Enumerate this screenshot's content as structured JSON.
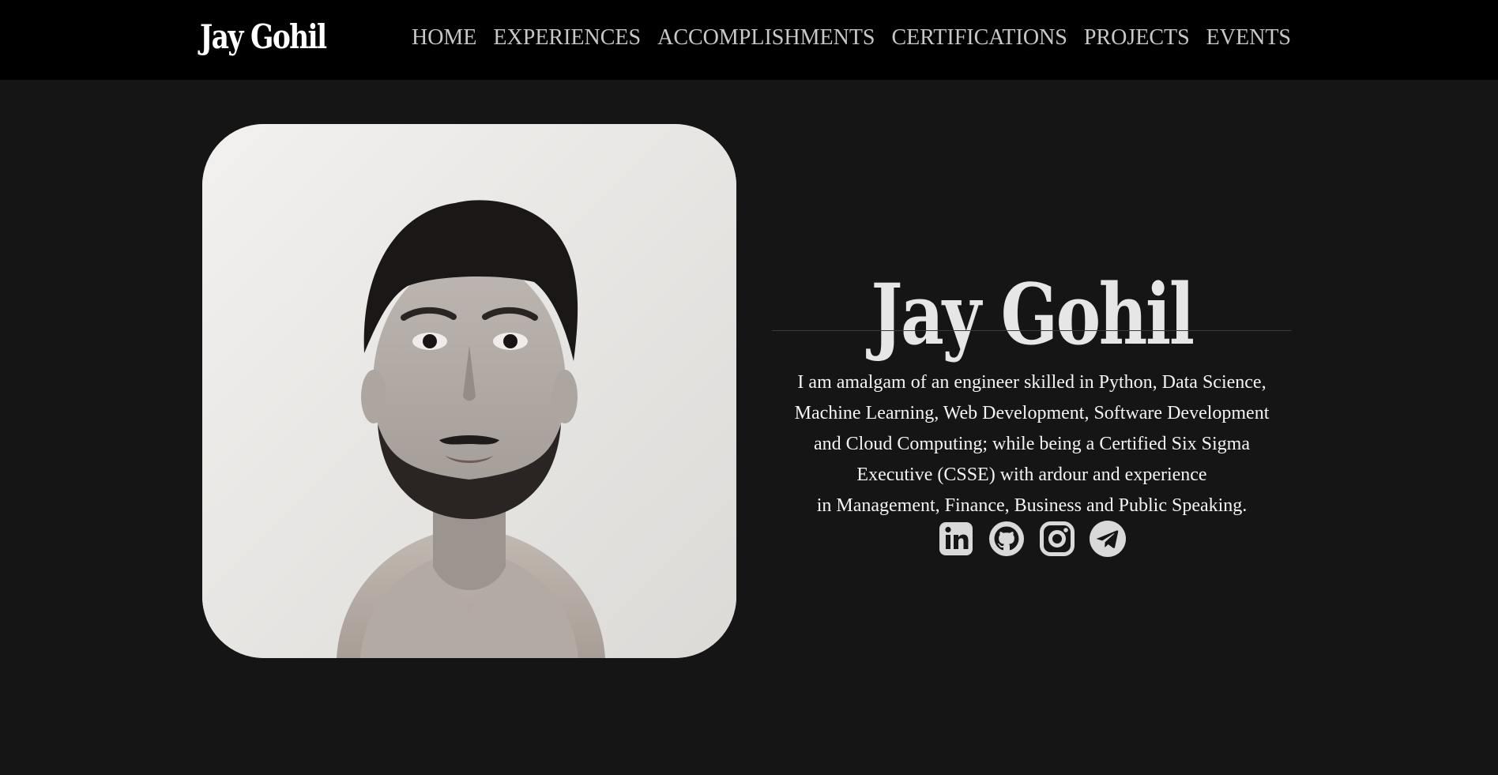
{
  "navbar": {
    "brand": "Jay Gohil",
    "links": [
      {
        "label": "HOME"
      },
      {
        "label": "EXPERIENCES"
      },
      {
        "label": "ACCOMPLISHMENTS"
      },
      {
        "label": "CERTIFICATIONS"
      },
      {
        "label": "PROJECTS"
      },
      {
        "label": "EVENTS"
      }
    ]
  },
  "hero": {
    "name": "Jay Gohil",
    "bio_lines": [
      "I am amalgam of an engineer skilled in Python, Data Science,",
      "Machine Learning, Web Development, Software Development",
      "and Cloud Computing; while being a Certified Six Sigma",
      "Executive (CSSE) with ardour and experience",
      "in Management, Finance, Business and Public Speaking."
    ],
    "socials": [
      {
        "icon": "linkedin-icon"
      },
      {
        "icon": "github-icon"
      },
      {
        "icon": "instagram-icon"
      },
      {
        "icon": "telegram-icon"
      }
    ]
  },
  "colors": {
    "page_background": "#151515",
    "navbar_background": "#000000",
    "nav_text": "#c8c8c8",
    "heading_text": "#e6e6e6",
    "body_text": "#f4f4f4",
    "icon_color": "#d9d9d9"
  }
}
